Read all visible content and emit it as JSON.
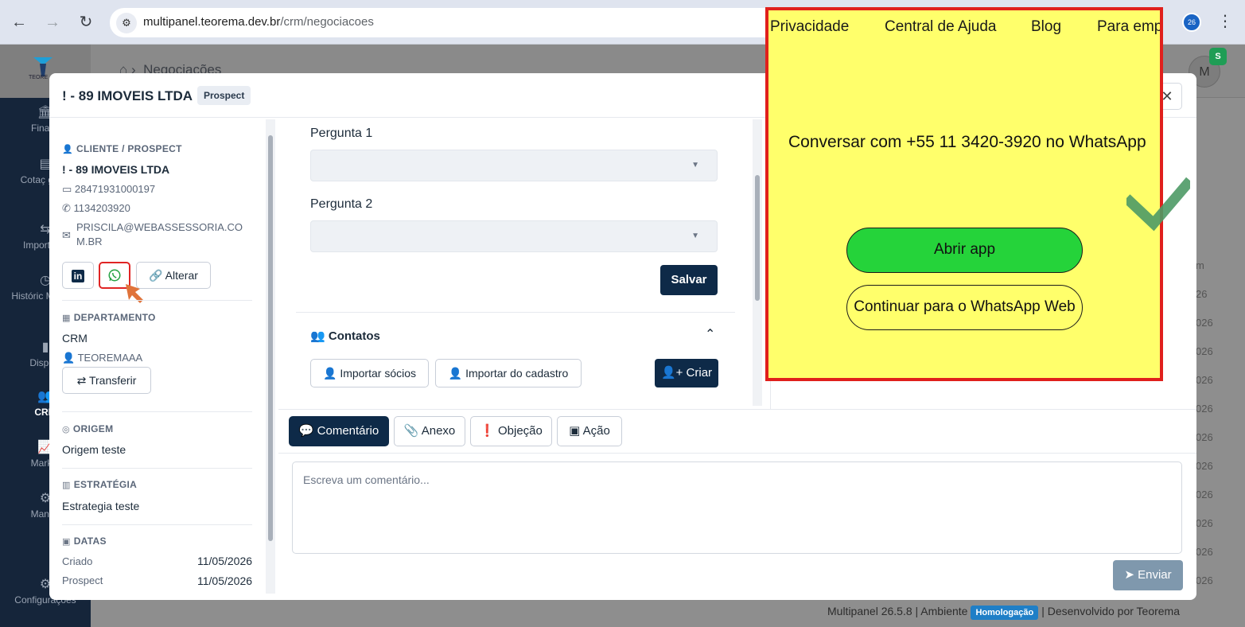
{
  "browser": {
    "url_host": "multipanel.teorema.dev.br",
    "url_path": "/crm/negociacoes",
    "back_icon": "←",
    "forward_icon": "→",
    "reload_icon": "↻",
    "kebab_icon": "⋮"
  },
  "app": {
    "logo_text": "TEORE",
    "breadcrumb": "Negociações",
    "avatar_initial": "M",
    "avatar_badge": "S",
    "sidebar": [
      {
        "label": "Financ",
        "icon": "bank-icon"
      },
      {
        "label": "Cotaç gerer",
        "icon": "quote-icon"
      },
      {
        "label": "Importar/E",
        "icon": "import-icon"
      },
      {
        "label": "Históric Movime",
        "icon": "history-icon"
      },
      {
        "label": "Disposi",
        "icon": "device-icon"
      },
      {
        "label": "CRM",
        "icon": "users-icon"
      },
      {
        "label": "Market",
        "icon": "chart-icon"
      },
      {
        "label": "Manag",
        "icon": "gear-icon"
      },
      {
        "label": "Configurações",
        "icon": "settings-icon"
      }
    ],
    "footer": {
      "version": "Multipanel 26.5.8",
      "env_label": "Ambiente",
      "env_badge": "Homologação",
      "dev": "Desenvolvido por Teorema"
    },
    "bg_column": [
      "m",
      "26",
      "026",
      "026",
      "026",
      "026",
      "026",
      "026",
      "026",
      "026",
      "026",
      "026"
    ]
  },
  "modal": {
    "title": "! - 89 IMOVEIS LTDA",
    "status": "Prospect",
    "close_icon": "✕",
    "client": {
      "section": "CLIENTE / PROSPECT",
      "name": "! - 89 IMOVEIS LTDA",
      "doc": "28471931000197",
      "phone": "1134203920",
      "email_line1": "PRISCILA@WEBASSESSORIA.CO",
      "email_line2": "M.BR",
      "linkedin_label": "in",
      "change_label": "Alterar"
    },
    "department": {
      "section": "DEPARTAMENTO",
      "name": "CRM",
      "user": "TEOREMAAA",
      "transfer_label": "Transferir"
    },
    "origin": {
      "section": "ORIGEM",
      "value": "Origem teste"
    },
    "strategy": {
      "section": "ESTRATÉGIA",
      "value": "Estrategia teste"
    },
    "dates": {
      "section": "DATAS",
      "created_label": "Criado",
      "created_value": "11/05/2026",
      "prospect_label": "Prospect",
      "prospect_value": "11/05/2026"
    },
    "questions": [
      {
        "label": "Pergunta 1"
      },
      {
        "label": "Pergunta 2"
      }
    ],
    "save_label": "Salvar",
    "contacts": {
      "title": "Contatos",
      "import_partners": "Importar sócios",
      "import_register": "Importar do cadastro",
      "create": "Criar"
    },
    "tabs": [
      "Comentário",
      "Anexo",
      "Objeção",
      "Ação"
    ],
    "comment_placeholder": "Escreva um comentário...",
    "send_label": "Enviar"
  },
  "whatsapp": {
    "nav": [
      "Privacidade",
      "Central de Ajuda",
      "Blog",
      "Para emp."
    ],
    "heading": "Conversar com +55 11 3420-3920 no WhatsApp",
    "open_app": "Abrir app",
    "web": "Continuar para o WhatsApp Web",
    "colors": {
      "bg": "#ffff6b",
      "button": "#25d33a",
      "border": "#e0201c"
    }
  }
}
